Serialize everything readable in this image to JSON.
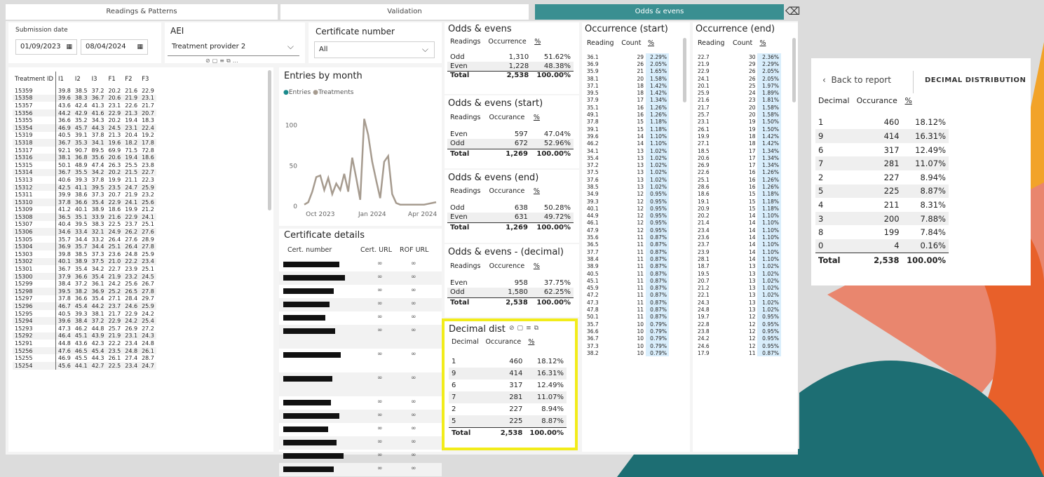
{
  "tabs": [
    "Readings & Patterns",
    "Validation",
    "Odds & evens"
  ],
  "filters": {
    "submission_label": "Submission date",
    "date_from": "01/09/2023",
    "date_to": "08/04/2024",
    "aei_label": "AEI",
    "aei_value": "Treatment provider 2",
    "cert_label": "Certificate number",
    "cert_value": "All"
  },
  "treatments": {
    "headers": [
      "Treatment ID",
      "I1",
      "I2",
      "I3",
      "F1",
      "F2",
      "F3"
    ],
    "rows": [
      [
        "15359",
        "39.8",
        "38.5",
        "37.2",
        "20.2",
        "21.6",
        "22.9"
      ],
      [
        "15358",
        "39.6",
        "38.3",
        "36.7",
        "20.6",
        "21.9",
        "23.1"
      ],
      [
        "15357",
        "43.6",
        "42.4",
        "41.3",
        "23.1",
        "22.6",
        "21.7"
      ],
      [
        "15356",
        "44.2",
        "42.9",
        "41.6",
        "22.9",
        "21.3",
        "20.7"
      ],
      [
        "15355",
        "36.6",
        "35.2",
        "34.3",
        "20.2",
        "19.4",
        "18.3"
      ],
      [
        "15354",
        "46.9",
        "45.7",
        "44.3",
        "24.5",
        "23.1",
        "22.4"
      ],
      [
        "15319",
        "40.5",
        "39.1",
        "37.8",
        "21.3",
        "20.4",
        "19.2"
      ],
      [
        "15318",
        "36.7",
        "35.3",
        "34.1",
        "19.6",
        "18.2",
        "17.8"
      ],
      [
        "15317",
        "92.1",
        "90.7",
        "89.5",
        "69.9",
        "71.5",
        "72.8"
      ],
      [
        "15316",
        "38.1",
        "36.8",
        "35.6",
        "20.6",
        "19.4",
        "18.6"
      ],
      [
        "15315",
        "50.1",
        "48.9",
        "47.4",
        "26.3",
        "25.5",
        "23.8"
      ],
      [
        "15314",
        "36.7",
        "35.5",
        "34.2",
        "20.2",
        "21.5",
        "22.7"
      ],
      [
        "15313",
        "40.6",
        "39.3",
        "37.8",
        "19.9",
        "21.1",
        "22.3"
      ],
      [
        "15312",
        "42.5",
        "41.1",
        "39.5",
        "23.5",
        "24.7",
        "25.9"
      ],
      [
        "15311",
        "39.9",
        "38.6",
        "37.3",
        "20.7",
        "21.9",
        "23.2"
      ],
      [
        "15310",
        "37.8",
        "36.6",
        "35.4",
        "22.9",
        "24.1",
        "25.6"
      ],
      [
        "15309",
        "41.2",
        "40.1",
        "38.9",
        "18.6",
        "19.9",
        "21.2"
      ],
      [
        "15308",
        "36.5",
        "35.1",
        "33.9",
        "21.6",
        "22.9",
        "24.1"
      ],
      [
        "15307",
        "40.4",
        "39.5",
        "38.3",
        "22.5",
        "23.7",
        "25.1"
      ],
      [
        "15306",
        "34.6",
        "33.4",
        "32.1",
        "24.9",
        "26.2",
        "27.6"
      ],
      [
        "15305",
        "35.7",
        "34.4",
        "33.2",
        "26.4",
        "27.6",
        "28.9"
      ],
      [
        "15304",
        "36.9",
        "35.7",
        "34.4",
        "25.1",
        "26.4",
        "27.8"
      ],
      [
        "15303",
        "39.8",
        "38.5",
        "37.3",
        "23.6",
        "24.8",
        "25.9"
      ],
      [
        "15302",
        "40.1",
        "38.9",
        "37.5",
        "21.0",
        "22.2",
        "23.4"
      ],
      [
        "15301",
        "36.7",
        "35.4",
        "34.2",
        "22.7",
        "23.9",
        "25.1"
      ],
      [
        "15300",
        "37.9",
        "36.6",
        "35.4",
        "21.9",
        "23.2",
        "24.5"
      ],
      [
        "15299",
        "38.4",
        "37.2",
        "36.1",
        "24.2",
        "25.6",
        "26.7"
      ],
      [
        "15298",
        "39.5",
        "38.2",
        "36.9",
        "25.2",
        "26.5",
        "27.8"
      ],
      [
        "15297",
        "37.8",
        "36.6",
        "35.4",
        "27.1",
        "28.4",
        "29.7"
      ],
      [
        "15296",
        "46.7",
        "45.4",
        "44.2",
        "23.7",
        "24.6",
        "25.9"
      ],
      [
        "15295",
        "40.5",
        "39.3",
        "38.1",
        "21.7",
        "22.9",
        "24.2"
      ],
      [
        "15294",
        "39.6",
        "38.4",
        "37.2",
        "22.9",
        "24.2",
        "25.4"
      ],
      [
        "15293",
        "47.3",
        "46.2",
        "44.8",
        "25.7",
        "26.9",
        "27.2"
      ],
      [
        "15292",
        "46.4",
        "45.1",
        "43.9",
        "21.9",
        "23.1",
        "24.3"
      ],
      [
        "15291",
        "44.8",
        "43.6",
        "42.3",
        "22.2",
        "23.4",
        "24.8"
      ],
      [
        "15256",
        "47.6",
        "46.5",
        "45.4",
        "23.5",
        "24.8",
        "26.1"
      ],
      [
        "15255",
        "46.9",
        "45.5",
        "44.3",
        "26.1",
        "27.4",
        "28.7"
      ],
      [
        "15254",
        "45.6",
        "44.1",
        "42.7",
        "22.5",
        "23.4",
        "24.7"
      ]
    ]
  },
  "chart_data": {
    "type": "line",
    "title": "Entries by month",
    "legend": [
      "Entries",
      "Treatments"
    ],
    "legend_colors": [
      "#1a8a8c",
      "#a69b8f"
    ],
    "yticks": [
      0,
      50,
      100
    ],
    "ylim": [
      0,
      130
    ],
    "xticks": [
      "Oct 2023",
      "Jan 2024",
      "Apr 2024"
    ],
    "color": "#a69b8f",
    "series": [
      {
        "name": "Treatments",
        "x": [
          0,
          1,
          2,
          3,
          4,
          5,
          6,
          7,
          8,
          9,
          10,
          11,
          12,
          13,
          14,
          15,
          16,
          17,
          18,
          19,
          20,
          21,
          22,
          23,
          24,
          25,
          26,
          27,
          28,
          29,
          30,
          31,
          32,
          33
        ],
        "values": [
          2,
          5,
          18,
          36,
          38,
          20,
          35,
          15,
          28,
          20,
          40,
          18,
          60,
          35,
          8,
          108,
          88,
          55,
          32,
          10,
          55,
          62,
          15,
          4,
          2,
          2,
          2,
          2,
          2,
          2,
          2,
          3,
          4,
          5
        ]
      }
    ]
  },
  "odds": {
    "title": "Odds & evens",
    "headers": [
      "Readings",
      "Occurrence",
      "%"
    ],
    "rows": [
      [
        "Odd",
        "1,310",
        "51.62%"
      ],
      [
        "Even",
        "1,228",
        "48.38%"
      ]
    ],
    "total": [
      "Total",
      "2,538",
      "100.00%"
    ]
  },
  "odds_start": {
    "title": "Odds & evens (start)",
    "headers": [
      "Readings",
      "Occurance",
      "%"
    ],
    "rows": [
      [
        "Even",
        "597",
        "47.04%"
      ],
      [
        "Odd",
        "672",
        "52.96%"
      ]
    ],
    "total": [
      "Total",
      "1,269",
      "100.00%"
    ]
  },
  "odds_end": {
    "title": "Odds & evens (end)",
    "headers": [
      "Readings",
      "Occurance",
      "%"
    ],
    "rows": [
      [
        "Odd",
        "638",
        "50.28%"
      ],
      [
        "Even",
        "631",
        "49.72%"
      ]
    ],
    "total": [
      "Total",
      "1,269",
      "100.00%"
    ]
  },
  "odds_dec": {
    "title": "Odds & evens - (decimal)",
    "headers": [
      "Readings",
      "Occurence",
      "%"
    ],
    "rows": [
      [
        "Even",
        "958",
        "37.75%"
      ],
      [
        "Odd",
        "1,580",
        "62.25%"
      ]
    ],
    "total": [
      "Total",
      "2,538",
      "100.00%"
    ]
  },
  "cert": {
    "title": "Certificate details",
    "headers": [
      "Cert. number",
      "Cert. URL",
      "ROF URL"
    ]
  },
  "decimal": {
    "title": "Decimal dist",
    "headers": [
      "Decimal",
      "Occurance",
      "%"
    ],
    "rows": [
      [
        "1",
        "460",
        "18.12%"
      ],
      [
        "9",
        "414",
        "16.31%"
      ],
      [
        "6",
        "317",
        "12.49%"
      ],
      [
        "7",
        "281",
        "11.07%"
      ],
      [
        "2",
        "227",
        "8.94%"
      ],
      [
        "5",
        "225",
        "8.87%"
      ]
    ],
    "total": [
      "Total",
      "2,538",
      "100.00%"
    ]
  },
  "occ_start": {
    "title": "Occurrence (start)",
    "headers": [
      "Reading",
      "Count",
      "%"
    ],
    "rows": [
      [
        "36.1",
        "29",
        "2.29%"
      ],
      [
        "36.9",
        "26",
        "2.05%"
      ],
      [
        "35.9",
        "21",
        "1.65%"
      ],
      [
        "38.1",
        "20",
        "1.58%"
      ],
      [
        "37.1",
        "18",
        "1.42%"
      ],
      [
        "39.5",
        "18",
        "1.42%"
      ],
      [
        "37.9",
        "17",
        "1.34%"
      ],
      [
        "35.1",
        "16",
        "1.26%"
      ],
      [
        "49.1",
        "16",
        "1.26%"
      ],
      [
        "37.8",
        "15",
        "1.18%"
      ],
      [
        "39.1",
        "15",
        "1.18%"
      ],
      [
        "39.6",
        "14",
        "1.10%"
      ],
      [
        "46.2",
        "14",
        "1.10%"
      ],
      [
        "34.1",
        "13",
        "1.02%"
      ],
      [
        "35.4",
        "13",
        "1.02%"
      ],
      [
        "37.2",
        "13",
        "1.02%"
      ],
      [
        "37.5",
        "13",
        "1.02%"
      ],
      [
        "37.6",
        "13",
        "1.02%"
      ],
      [
        "38.5",
        "13",
        "1.02%"
      ],
      [
        "34.9",
        "12",
        "0.95%"
      ],
      [
        "39.3",
        "12",
        "0.95%"
      ],
      [
        "40.1",
        "12",
        "0.95%"
      ],
      [
        "44.9",
        "12",
        "0.95%"
      ],
      [
        "46.1",
        "12",
        "0.95%"
      ],
      [
        "47.9",
        "12",
        "0.95%"
      ],
      [
        "35.6",
        "11",
        "0.87%"
      ],
      [
        "36.5",
        "11",
        "0.87%"
      ],
      [
        "37.7",
        "11",
        "0.87%"
      ],
      [
        "38.4",
        "11",
        "0.87%"
      ],
      [
        "38.9",
        "11",
        "0.87%"
      ],
      [
        "40.5",
        "11",
        "0.87%"
      ],
      [
        "45.1",
        "11",
        "0.87%"
      ],
      [
        "45.9",
        "11",
        "0.87%"
      ],
      [
        "47.2",
        "11",
        "0.87%"
      ],
      [
        "47.3",
        "11",
        "0.87%"
      ],
      [
        "47.8",
        "11",
        "0.87%"
      ],
      [
        "50.1",
        "11",
        "0.87%"
      ],
      [
        "35.7",
        "10",
        "0.79%"
      ],
      [
        "36.6",
        "10",
        "0.79%"
      ],
      [
        "36.7",
        "10",
        "0.79%"
      ],
      [
        "37.3",
        "10",
        "0.79%"
      ],
      [
        "38.2",
        "10",
        "0.79%"
      ]
    ]
  },
  "occ_end": {
    "title": "Occurrence (end)",
    "headers": [
      "Reading",
      "Count",
      "%"
    ],
    "rows": [
      [
        "22.7",
        "30",
        "2.36%"
      ],
      [
        "21.9",
        "29",
        "2.29%"
      ],
      [
        "22.9",
        "26",
        "2.05%"
      ],
      [
        "24.1",
        "26",
        "2.05%"
      ],
      [
        "20.1",
        "25",
        "1.97%"
      ],
      [
        "25.9",
        "24",
        "1.89%"
      ],
      [
        "21.6",
        "23",
        "1.81%"
      ],
      [
        "21.7",
        "20",
        "1.58%"
      ],
      [
        "25.7",
        "20",
        "1.58%"
      ],
      [
        "23.1",
        "19",
        "1.50%"
      ],
      [
        "26.1",
        "19",
        "1.50%"
      ],
      [
        "19.9",
        "18",
        "1.42%"
      ],
      [
        "27.1",
        "18",
        "1.42%"
      ],
      [
        "18.5",
        "17",
        "1.34%"
      ],
      [
        "20.6",
        "17",
        "1.34%"
      ],
      [
        "26.9",
        "17",
        "1.34%"
      ],
      [
        "22.6",
        "16",
        "1.26%"
      ],
      [
        "25.1",
        "16",
        "1.26%"
      ],
      [
        "28.6",
        "16",
        "1.26%"
      ],
      [
        "18.6",
        "15",
        "1.18%"
      ],
      [
        "19.1",
        "15",
        "1.18%"
      ],
      [
        "20.9",
        "15",
        "1.18%"
      ],
      [
        "20.2",
        "14",
        "1.10%"
      ],
      [
        "21.4",
        "14",
        "1.10%"
      ],
      [
        "23.4",
        "14",
        "1.10%"
      ],
      [
        "23.6",
        "14",
        "1.10%"
      ],
      [
        "23.7",
        "14",
        "1.10%"
      ],
      [
        "23.9",
        "14",
        "1.10%"
      ],
      [
        "28.1",
        "14",
        "1.10%"
      ],
      [
        "18.7",
        "13",
        "1.02%"
      ],
      [
        "19.5",
        "13",
        "1.02%"
      ],
      [
        "20.7",
        "13",
        "1.02%"
      ],
      [
        "21.2",
        "13",
        "1.02%"
      ],
      [
        "22.1",
        "13",
        "1.02%"
      ],
      [
        "24.3",
        "13",
        "1.02%"
      ],
      [
        "24.8",
        "13",
        "1.02%"
      ],
      [
        "19.7",
        "12",
        "0.95%"
      ],
      [
        "22.8",
        "12",
        "0.95%"
      ],
      [
        "23.8",
        "12",
        "0.95%"
      ],
      [
        "24.2",
        "12",
        "0.95%"
      ],
      [
        "24.6",
        "12",
        "0.95%"
      ],
      [
        "17.9",
        "11",
        "0.87%"
      ]
    ]
  },
  "popup": {
    "back": "Back to report",
    "title": "DECIMAL DISTRIBUTION",
    "headers": [
      "Decimal",
      "Occurance",
      "%"
    ],
    "rows": [
      [
        "1",
        "460",
        "18.12%"
      ],
      [
        "9",
        "414",
        "16.31%"
      ],
      [
        "6",
        "317",
        "12.49%"
      ],
      [
        "7",
        "281",
        "11.07%"
      ],
      [
        "2",
        "227",
        "8.94%"
      ],
      [
        "5",
        "225",
        "8.87%"
      ],
      [
        "4",
        "211",
        "8.31%"
      ],
      [
        "3",
        "200",
        "7.88%"
      ],
      [
        "8",
        "199",
        "7.84%"
      ],
      [
        "0",
        "4",
        "0.16%"
      ]
    ],
    "total": [
      "Total",
      "2,538",
      "100.00%"
    ]
  },
  "icons": [
    "pin-icon",
    "copy-icon",
    "filter-icon",
    "focus-icon",
    "more-icon",
    "calendar-icon",
    "chevron-down-icon",
    "link-icon",
    "eraser-icon",
    "back-chevron-icon"
  ]
}
